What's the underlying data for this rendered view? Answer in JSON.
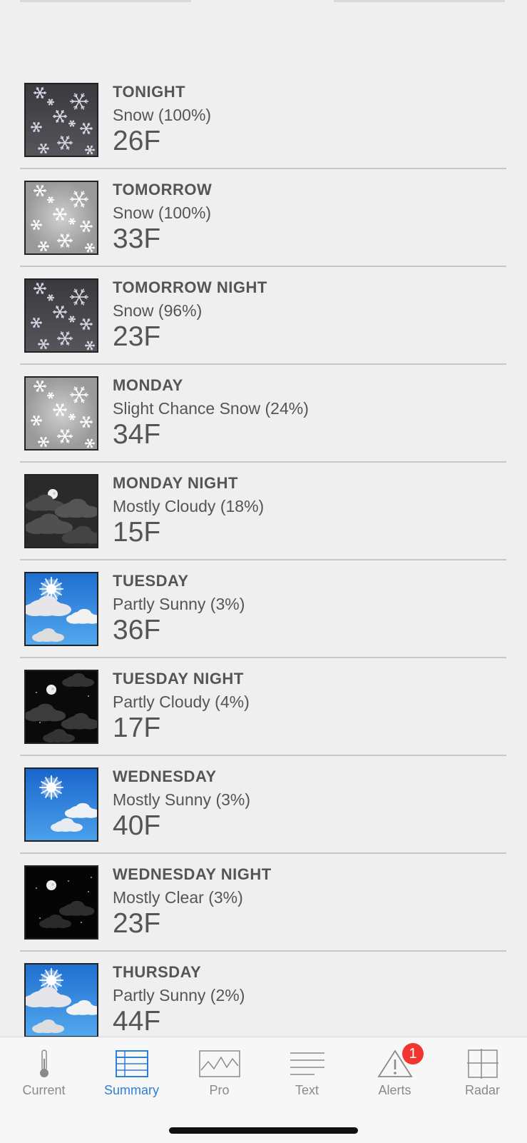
{
  "forecast": [
    {
      "period": "TONIGHT",
      "condition": "Snow (100%)",
      "temp": "26F",
      "icon": "snow-night-icon",
      "sky": "night-snow"
    },
    {
      "period": "TOMORROW",
      "condition": "Snow (100%)",
      "temp": "33F",
      "icon": "snow-day-icon",
      "sky": "day-snow"
    },
    {
      "period": "TOMORROW NIGHT",
      "condition": "Snow (96%)",
      "temp": "23F",
      "icon": "snow-night-icon",
      "sky": "night-snow"
    },
    {
      "period": "MONDAY",
      "condition": "Slight Chance Snow (24%)",
      "temp": "34F",
      "icon": "snow-day-icon",
      "sky": "day-snow"
    },
    {
      "period": "MONDAY NIGHT",
      "condition": "Mostly Cloudy (18%)",
      "temp": "15F",
      "icon": "cloudy-night-icon",
      "sky": "night-cloudy"
    },
    {
      "period": "TUESDAY",
      "condition": "Partly Sunny (3%)",
      "temp": "36F",
      "icon": "partly-sunny-icon",
      "sky": "partly-sunny"
    },
    {
      "period": "TUESDAY NIGHT",
      "condition": "Partly Cloudy (4%)",
      "temp": "17F",
      "icon": "partly-cloudy-night-icon",
      "sky": "partly-cloudy-night"
    },
    {
      "period": "WEDNESDAY",
      "condition": "Mostly Sunny (3%)",
      "temp": "40F",
      "icon": "mostly-sunny-icon",
      "sky": "mostly-sunny"
    },
    {
      "period": "WEDNESDAY NIGHT",
      "condition": "Mostly Clear (3%)",
      "temp": "23F",
      "icon": "clear-night-icon",
      "sky": "clear-night"
    },
    {
      "period": "THURSDAY",
      "condition": "Partly Sunny (2%)",
      "temp": "44F",
      "icon": "partly-sunny-icon",
      "sky": "partly-sunny"
    }
  ],
  "tabs": [
    {
      "label": "Current",
      "icon": "thermometer-icon",
      "active": false
    },
    {
      "label": "Summary",
      "icon": "table-icon",
      "active": true
    },
    {
      "label": "Pro",
      "icon": "graph-icon",
      "active": false
    },
    {
      "label": "Text",
      "icon": "text-lines-icon",
      "active": false
    },
    {
      "label": "Alerts",
      "icon": "warning-icon",
      "active": false,
      "badge": "1"
    },
    {
      "label": "Radar",
      "icon": "grid-icon",
      "active": false
    }
  ],
  "colors": {
    "accent": "#2e7fd6",
    "badge": "#f0362f"
  }
}
